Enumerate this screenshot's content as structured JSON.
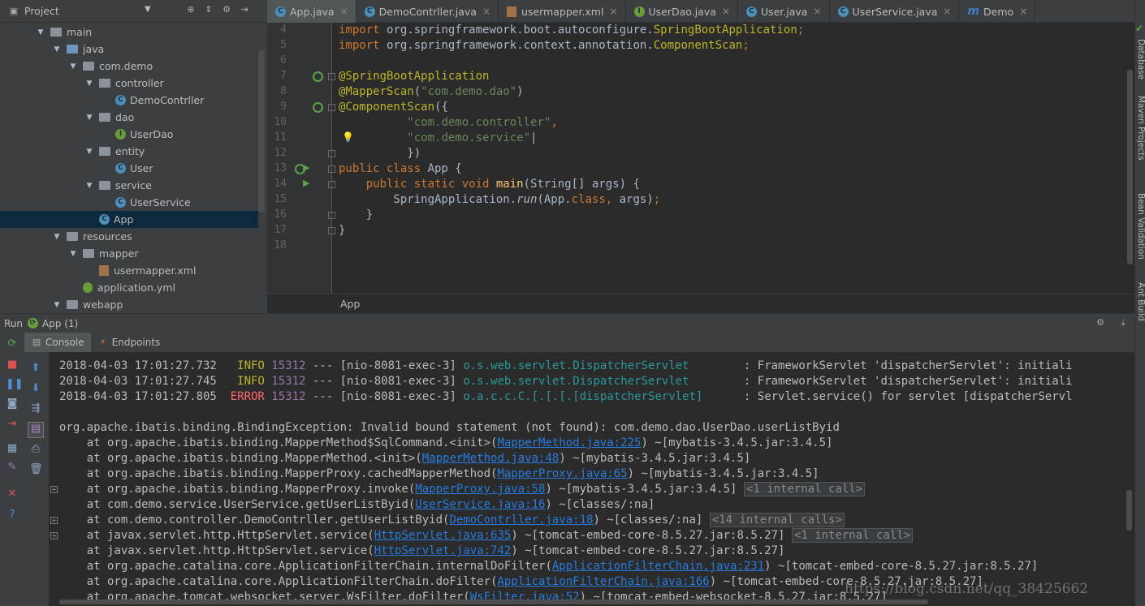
{
  "project": {
    "title": "Project",
    "tree": [
      {
        "label": "main",
        "type": "folder",
        "depth": 0
      },
      {
        "label": "java",
        "type": "folder-blue",
        "depth": 1
      },
      {
        "label": "com.demo",
        "type": "package",
        "depth": 2
      },
      {
        "label": "controller",
        "type": "package",
        "depth": 3
      },
      {
        "label": "DemoContrller",
        "type": "class",
        "depth": 4
      },
      {
        "label": "dao",
        "type": "package",
        "depth": 3
      },
      {
        "label": "UserDao",
        "type": "interface",
        "depth": 4
      },
      {
        "label": "entity",
        "type": "package",
        "depth": 3
      },
      {
        "label": "User",
        "type": "class",
        "depth": 4
      },
      {
        "label": "service",
        "type": "package",
        "depth": 3
      },
      {
        "label": "UserService",
        "type": "class",
        "depth": 4
      },
      {
        "label": "App",
        "type": "app",
        "depth": 3,
        "selected": true
      },
      {
        "label": "resources",
        "type": "folder",
        "depth": 1
      },
      {
        "label": "mapper",
        "type": "folder",
        "depth": 2
      },
      {
        "label": "usermapper.xml",
        "type": "xml",
        "depth": 3
      },
      {
        "label": "application.yml",
        "type": "yml",
        "depth": 2
      },
      {
        "label": "webapp",
        "type": "folder",
        "depth": 1
      }
    ]
  },
  "tabs": [
    {
      "label": "App.java",
      "icon": "C",
      "color": "#4e8fb7",
      "active": true
    },
    {
      "label": "DemoContrller.java",
      "icon": "C",
      "color": "#4e8fb7"
    },
    {
      "label": "usermapper.xml",
      "icon": "xml",
      "color": "#a1734b"
    },
    {
      "label": "UserDao.java",
      "icon": "I",
      "color": "#6a9c3a"
    },
    {
      "label": "User.java",
      "icon": "C",
      "color": "#4e8fb7"
    },
    {
      "label": "UserService.java",
      "icon": "C",
      "color": "#4e8fb7"
    },
    {
      "label": "Demo",
      "icon": "m",
      "color": "#3d7dc9"
    }
  ],
  "editor": {
    "line_numbers": [
      "4",
      "5",
      "6",
      "7",
      "8",
      "9",
      "10",
      "11",
      "12",
      "13",
      "14",
      "15",
      "16",
      "17",
      "18"
    ],
    "lines": [
      [
        [
          "kw",
          "import "
        ],
        [
          "",
          "org.springframework.boot.autoconfigure."
        ],
        [
          "ann",
          "SpringBootApplication"
        ],
        [
          "kw",
          ";"
        ]
      ],
      [
        [
          "kw",
          "import "
        ],
        [
          "",
          "org.springframework.context.annotation."
        ],
        [
          "ann",
          "ComponentScan"
        ],
        [
          "kw",
          ";"
        ]
      ],
      [],
      [
        [
          "ann",
          "@SpringBootApplication"
        ]
      ],
      [
        [
          "ann",
          "@MapperScan"
        ],
        [
          "",
          "("
        ],
        [
          "str",
          "\"com.demo.dao\""
        ],
        [
          "",
          ")"
        ]
      ],
      [
        [
          "ann",
          "@ComponentScan"
        ],
        [
          "",
          "({"
        ]
      ],
      [
        [
          "",
          "          "
        ],
        [
          "str",
          "\"com.demo.controller\""
        ],
        [
          "kw",
          ","
        ]
      ],
      [
        [
          "",
          "          "
        ],
        [
          "str",
          "\"com.demo.service\""
        ],
        [
          "",
          "|"
        ]
      ],
      [
        [
          "",
          "          })"
        ]
      ],
      [
        [
          "kw",
          "public class "
        ],
        [
          "",
          "App {"
        ]
      ],
      [
        [
          "",
          "    "
        ],
        [
          "kw",
          "public static void "
        ],
        [
          "fn",
          "main"
        ],
        [
          "",
          "(String[] args) {"
        ]
      ],
      [
        [
          "",
          "        SpringApplication."
        ],
        [
          "ital",
          "run"
        ],
        [
          "",
          "(App."
        ],
        [
          "kw",
          "class"
        ],
        [
          "kw",
          ", "
        ],
        [
          "",
          "args)"
        ],
        [
          "kw",
          ";"
        ]
      ],
      [
        [
          "",
          "    }"
        ]
      ],
      [
        [
          "",
          "}"
        ]
      ],
      []
    ],
    "breadcrumb": "App"
  },
  "right_stripe": [
    "Database",
    "Maven Projects",
    "Bean Validation",
    "Ant Build"
  ],
  "run": {
    "label": "Run",
    "config": "App (1)",
    "tabs": [
      "Console",
      "Endpoints"
    ]
  },
  "console": {
    "log_lines": [
      {
        "date": "2018-04-03 17:01:27.732",
        "level": "INFO",
        "pid": "15312",
        "thread": "--- [nio-8081-exec-3]",
        "logger": "o.s.web.servlet.DispatcherServlet",
        "msg": ": FrameworkServlet 'dispatcherServlet': initiali"
      },
      {
        "date": "2018-04-03 17:01:27.745",
        "level": "INFO",
        "pid": "15312",
        "thread": "--- [nio-8081-exec-3]",
        "logger": "o.s.web.servlet.DispatcherServlet",
        "msg": ": FrameworkServlet 'dispatcherServlet': initiali"
      },
      {
        "date": "2018-04-03 17:01:27.805",
        "level": "ERROR",
        "pid": "15312",
        "thread": "--- [nio-8081-exec-3]",
        "logger": "o.a.c.c.C.[.[.[.[dispatcherServlet]",
        "msg": ": Servlet.service() for servlet [dispatcherServl"
      }
    ],
    "exception": "org.apache.ibatis.binding.BindingException: Invalid bound statement (not found): com.demo.dao.UserDao.userListByid",
    "stack": [
      {
        "pre": "    at org.apache.ibatis.binding.MapperMethod$SqlCommand.<init>(",
        "link": "MapperMethod.java:225",
        "post": ") ~[mybatis-3.4.5.jar:3.4.5]",
        "box": "",
        "expand": false
      },
      {
        "pre": "    at org.apache.ibatis.binding.MapperMethod.<init>(",
        "link": "MapperMethod.java:48",
        "post": ") ~[mybatis-3.4.5.jar:3.4.5]",
        "box": "",
        "expand": false
      },
      {
        "pre": "    at org.apache.ibatis.binding.MapperProxy.cachedMapperMethod(",
        "link": "MapperProxy.java:65",
        "post": ") ~[mybatis-3.4.5.jar:3.4.5]",
        "box": "",
        "expand": false
      },
      {
        "pre": "    at org.apache.ibatis.binding.MapperProxy.invoke(",
        "link": "MapperProxy.java:58",
        "post": ") ~[mybatis-3.4.5.jar:3.4.5]",
        "box": "<1 internal call>",
        "expand": true
      },
      {
        "pre": "    at com.demo.service.UserService.getUserListByid(",
        "link": "UserService.java:16",
        "post": ") ~[classes/:na]",
        "box": "",
        "expand": false
      },
      {
        "pre": "    at com.demo.controller.DemoContrller.getUserListByid(",
        "link": "DemoContrller.java:18",
        "post": ") ~[classes/:na]",
        "box": "<14 internal calls>",
        "expand": true
      },
      {
        "pre": "    at javax.servlet.http.HttpServlet.service(",
        "link": "HttpServlet.java:635",
        "post": ") ~[tomcat-embed-core-8.5.27.jar:8.5.27]",
        "box": "<1 internal call>",
        "expand": true
      },
      {
        "pre": "    at javax.servlet.http.HttpServlet.service(",
        "link": "HttpServlet.java:742",
        "post": ") ~[tomcat-embed-core-8.5.27.jar:8.5.27]",
        "box": "",
        "expand": false
      },
      {
        "pre": "    at org.apache.catalina.core.ApplicationFilterChain.internalDoFilter(",
        "link": "ApplicationFilterChain.java:231",
        "post": ") ~[tomcat-embed-core-8.5.27.jar:8.5.27]",
        "box": "",
        "expand": false
      },
      {
        "pre": "    at org.apache.catalina.core.ApplicationFilterChain.doFilter(",
        "link": "ApplicationFilterChain.java:166",
        "post": ") ~[tomcat-embed-core-8.5.27.jar:8.5.27]",
        "box": "",
        "expand": false
      },
      {
        "pre": "    at org.apache.tomcat.websocket.server.WsFilter.doFilter(",
        "link": "WsFilter.java:52",
        "post": ") ~[tomcat-embed-websocket-8.5.27.jar:8.5.27]",
        "box": "",
        "expand": false
      }
    ]
  },
  "watermark": "https://blog.csdn.net/qq_38425662"
}
